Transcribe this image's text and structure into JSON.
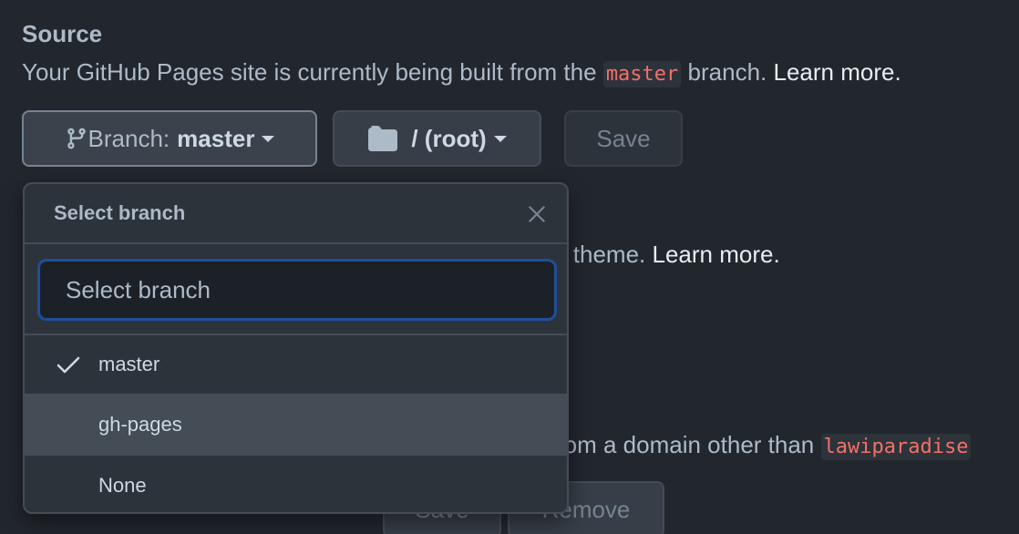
{
  "source": {
    "heading": "Source",
    "description_prefix": "Your GitHub Pages site is currently being built from the",
    "branch_code": "master",
    "description_suffix": "branch.",
    "learn_more": "Learn more."
  },
  "controls": {
    "branch_prefix": "Branch:",
    "branch_value": "master",
    "folder_value": "/ (root)",
    "save_label": "Save"
  },
  "background": {
    "theme_text_fragment": "ll theme.",
    "theme_learn_more": "Learn more.",
    "domain_text_fragment": "rom a domain other than",
    "domain_code_fragment": "lawiparadise",
    "save_fragment": "Save",
    "remove_fragment": "Remove"
  },
  "dropdown": {
    "title": "Select branch",
    "filter_placeholder": "Select branch",
    "items": [
      {
        "label": "master",
        "selected": true
      },
      {
        "label": "gh-pages",
        "selected": false
      },
      {
        "label": "None",
        "selected": false
      }
    ]
  },
  "colors": {
    "background": "#22272e",
    "code_text": "#f47067",
    "focus_ring": "#1f4f9a"
  }
}
